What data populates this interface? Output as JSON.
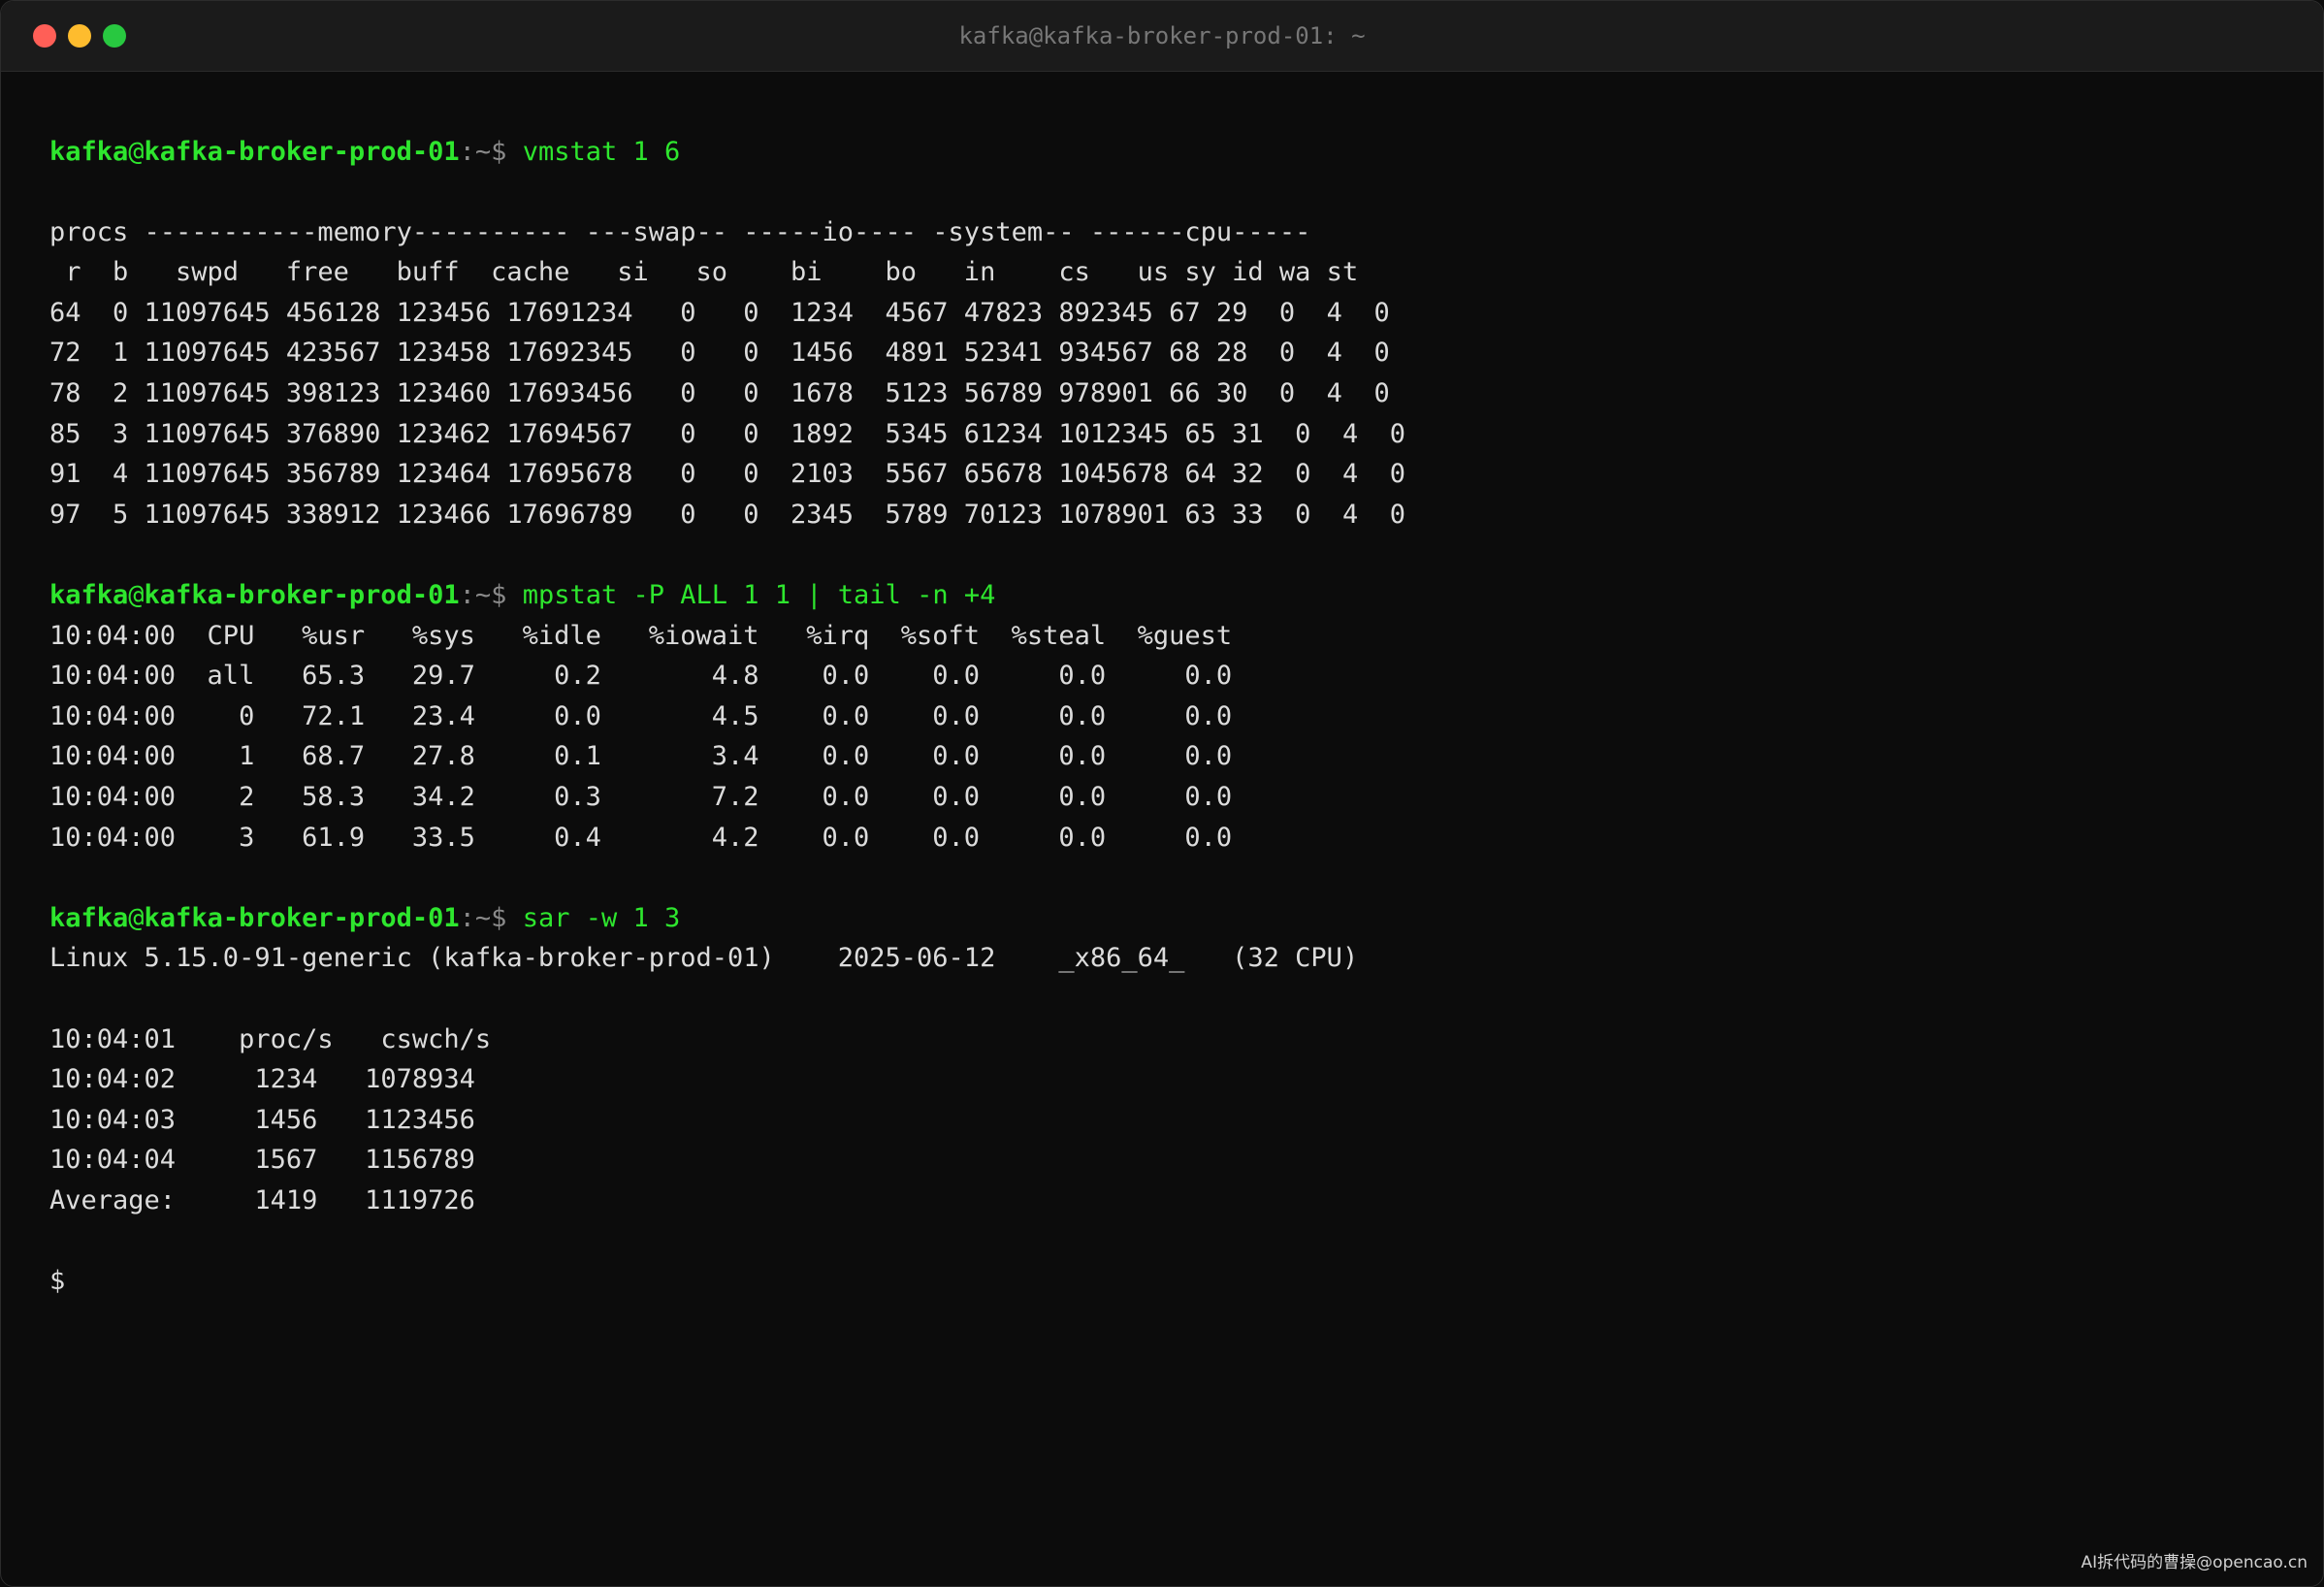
{
  "window": {
    "title": "kafka@kafka-broker-prod-01: ~",
    "colors": {
      "close": "#ff5f57",
      "minimize": "#febc2e",
      "maximize": "#28c840",
      "prompt": "#2ee62e"
    }
  },
  "prompt": {
    "user": "kafka",
    "at": "@",
    "host": "kafka-broker-prod-01",
    "path": ":~$"
  },
  "sections": [
    {
      "command": " vmstat 1 6",
      "output": [
        "",
        "procs -----------memory---------- ---swap-- -----io---- -system-- ------cpu-----",
        " r  b   swpd   free   buff  cache   si   so    bi    bo   in    cs   us sy id wa st",
        "64  0 11097645 456128 123456 17691234   0   0  1234  4567 47823 892345 67 29  0  4  0",
        "72  1 11097645 423567 123458 17692345   0   0  1456  4891 52341 934567 68 28  0  4  0",
        "78  2 11097645 398123 123460 17693456   0   0  1678  5123 56789 978901 66 30  0  4  0",
        "85  3 11097645 376890 123462 17694567   0   0  1892  5345 61234 1012345 65 31  0  4  0",
        "91  4 11097645 356789 123464 17695678   0   0  2103  5567 65678 1045678 64 32  0  4  0",
        "97  5 11097645 338912 123466 17696789   0   0  2345  5789 70123 1078901 63 33  0  4  0",
        ""
      ]
    },
    {
      "command": " mpstat -P ALL 1 1 | tail -n +4",
      "output": [
        "10:04:00  CPU   %usr   %sys   %idle   %iowait   %irq  %soft  %steal  %guest",
        "10:04:00  all   65.3   29.7     0.2       4.8    0.0    0.0     0.0     0.0",
        "10:04:00    0   72.1   23.4     0.0       4.5    0.0    0.0     0.0     0.0",
        "10:04:00    1   68.7   27.8     0.1       3.4    0.0    0.0     0.0     0.0",
        "10:04:00    2   58.3   34.2     0.3       7.2    0.0    0.0     0.0     0.0",
        "10:04:00    3   61.9   33.5     0.4       4.2    0.0    0.0     0.0     0.0",
        ""
      ]
    },
    {
      "command": " sar -w 1 3",
      "output": [
        "Linux 5.15.0-91-generic (kafka-broker-prod-01)    2025-06-12    _x86_64_   (32 CPU)",
        "",
        "10:04:01    proc/s   cswch/s",
        "10:04:02     1234   1078934",
        "10:04:03     1456   1123456",
        "10:04:04     1567   1156789",
        "Average:     1419   1119726",
        ""
      ]
    }
  ],
  "final_prompt": "$",
  "watermark": "AI拆代码的曹操@opencao.cn"
}
